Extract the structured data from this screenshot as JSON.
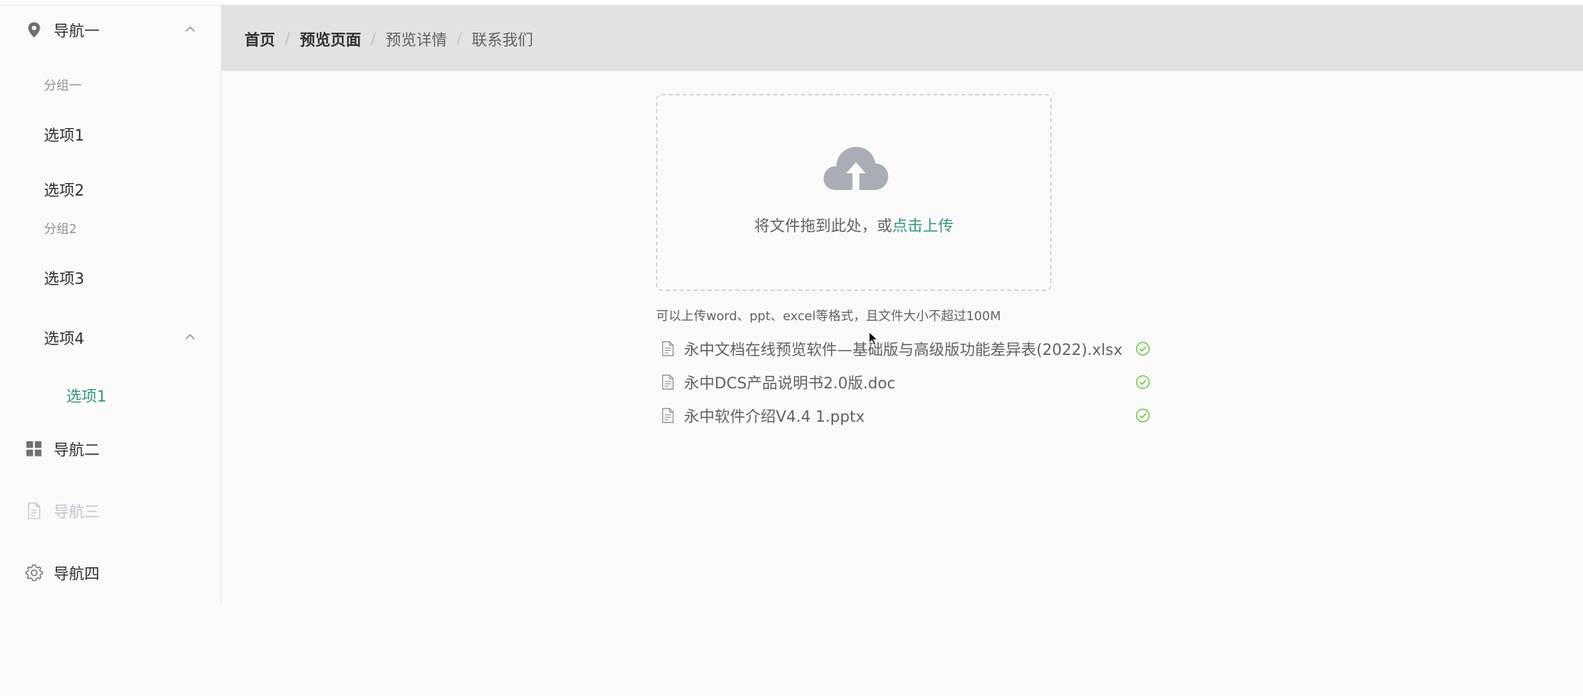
{
  "sidebar": {
    "nav1": {
      "label": "导航一",
      "icon": "location-icon"
    },
    "group1": "分组一",
    "item1": "选项1",
    "item2": "选项2",
    "group2": "分组2",
    "item3": "选项3",
    "item4": "选项4",
    "item4_sub1": "选项1",
    "nav2": {
      "label": "导航二",
      "icon": "grid-icon"
    },
    "nav3": {
      "label": "导航三",
      "icon": "document-icon"
    },
    "nav4": {
      "label": "导航四",
      "icon": "gear-icon"
    }
  },
  "breadcrumb": [
    "首页",
    "预览页面",
    "预览详情",
    "联系我们"
  ],
  "upload": {
    "drop_text": "将文件拖到此处，或",
    "click_text": "点击上传",
    "tip": "可以上传word、ppt、excel等格式，且文件大小不超过100M"
  },
  "files": [
    "永中文档在线预览软件—基础版与高级版功能差异表(2022).xlsx",
    "永中DCS产品说明书2.0版.doc",
    "永中软件介绍V4.4 1.pptx"
  ],
  "colors": {
    "accent": "#3a9384",
    "success": "#67c23a",
    "header_bg": "#e2e2e2"
  }
}
